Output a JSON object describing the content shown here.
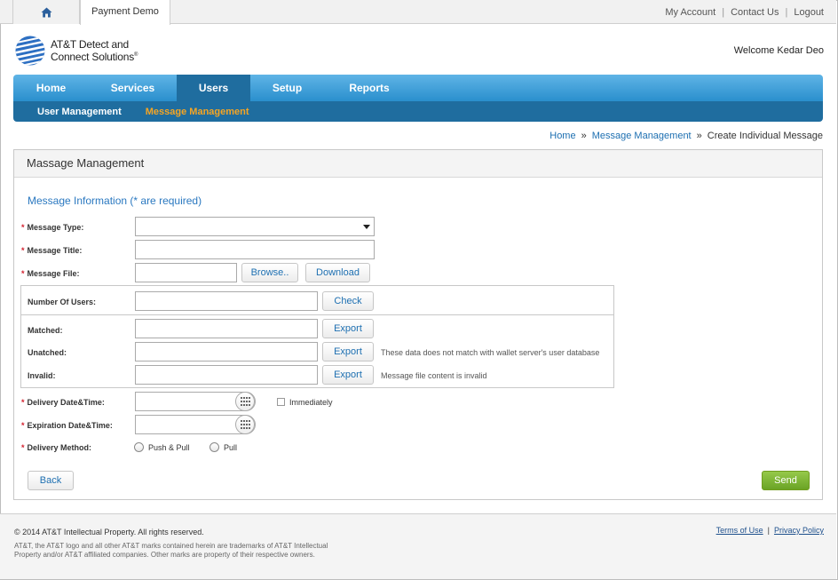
{
  "topbar": {
    "home_icon": "home-icon",
    "tab_label": "Payment Demo",
    "links": [
      "My Account",
      "Contact Us",
      "Logout"
    ]
  },
  "header": {
    "brand_line1": "AT&T Detect and",
    "brand_line2": "Connect Solutions",
    "brand_mark": "®",
    "welcome": "Welcome Kedar Deo"
  },
  "nav": {
    "main": [
      {
        "label": "Home",
        "active": false
      },
      {
        "label": "Services",
        "active": false
      },
      {
        "label": "Users",
        "active": true
      },
      {
        "label": "Setup",
        "active": false
      },
      {
        "label": "Reports",
        "active": false
      }
    ],
    "sub": [
      {
        "label": "User Management",
        "active": false
      },
      {
        "label": "Message Management",
        "active": true
      }
    ]
  },
  "breadcrumb": {
    "items": [
      "Home",
      "Message Management"
    ],
    "current": "Create Individual Message",
    "separator": "»"
  },
  "panel": {
    "title": "Massage Management",
    "section_title": "Message Information (* are required)",
    "required_mark": "*",
    "fields": {
      "message_type": "Message Type:",
      "message_title": "Message Title:",
      "message_file": "Message File:",
      "number_of_users": "Number Of Users:",
      "matched": "Matched:",
      "unmatched": "Unatched:",
      "invalid": "Invalid:",
      "delivery_datetime": "Delivery Date&Time:",
      "expiration_datetime": "Expiration Date&Time:",
      "delivery_method": "Delivery Method:"
    },
    "buttons": {
      "browse": "Browse..",
      "download": "Download",
      "check": "Check",
      "export": "Export",
      "back": "Back",
      "send": "Send"
    },
    "notes": {
      "unmatched": "These data does not match with wallet server's user database",
      "invalid": "Message file content is invalid"
    },
    "immediately": "Immediately",
    "methods": [
      "Push & Pull",
      "Pull"
    ]
  },
  "footer": {
    "copyright": "© 2014 AT&T Intellectual Property. All rights reserved.",
    "legal": "AT&T, the AT&T logo and all other AT&T marks contained herein are trademarks of AT&T Intellectual Property and/or AT&T affiliated companies. Other marks are property of their respective owners.",
    "links": [
      "Terms of Use",
      "Privacy Policy"
    ]
  },
  "colors": {
    "nav_blue": "#2a8fcd",
    "nav_dark": "#1f6d9f",
    "sub_active": "#f6a523",
    "link": "#1d6fb1",
    "send_green": "#7ab532",
    "required": "#d3202e"
  }
}
